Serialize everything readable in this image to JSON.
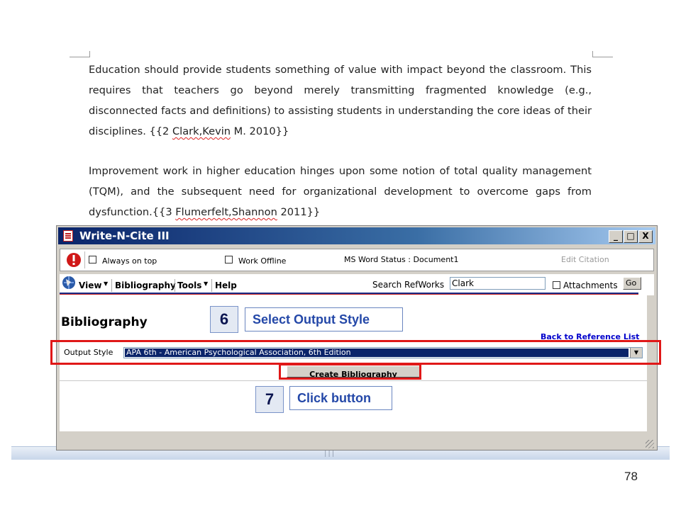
{
  "document": {
    "paragraph1": {
      "text": "Education should provide students something of value with impact beyond the classroom. This requires that teachers go beyond merely transmitting fragmented knowledge (e.g., disconnected facts and definitions) to assisting students in understanding the core ideas of their disciplines.  ",
      "citation_open": "{{2 ",
      "citation_name": "Clark,Kevin",
      "citation_close": " M. 2010}}"
    },
    "paragraph2": {
      "text": "Improvement work in higher education hinges upon some notion of total quality management (TQM), and the subsequent need for organizational development to overcome gaps from dysfunction.",
      "citation_open": "{{3 ",
      "citation_name": "Flumerfelt,Shannon",
      "citation_close": " 2011}}"
    }
  },
  "window": {
    "title": "Write-N-Cite III",
    "controls": {
      "minimize": "_",
      "maximize": "□",
      "close": "X"
    }
  },
  "toolbar": {
    "always_on_top": "Always on top",
    "work_offline": "Work Offline",
    "ms_word_status": "MS Word Status : Document1",
    "edit_citation": "Edit Citation"
  },
  "menu": {
    "view": "View",
    "bibliography": "Bibliography",
    "tools": "Tools",
    "help": "Help",
    "search_label": "Search RefWorks",
    "search_value": "Clark",
    "attachments": "Attachments",
    "go": "Go"
  },
  "panel": {
    "heading": "Bibliography",
    "back_link": "Back to Reference List",
    "output_style_label": "Output Style",
    "output_style_value": "APA 6th - American Psychological Association, 6th Edition",
    "create_button": "Create Bibliography"
  },
  "callouts": {
    "step6_number": "6",
    "step6_label": "Select Output Style",
    "step7_number": "7",
    "step7_label": "Click button"
  },
  "slide": {
    "page_number": "78"
  },
  "colors": {
    "titlebar_start": "#0a246a",
    "highlight_red": "#e01818",
    "callout_text": "#2448a8",
    "link_blue": "#0000cc"
  }
}
